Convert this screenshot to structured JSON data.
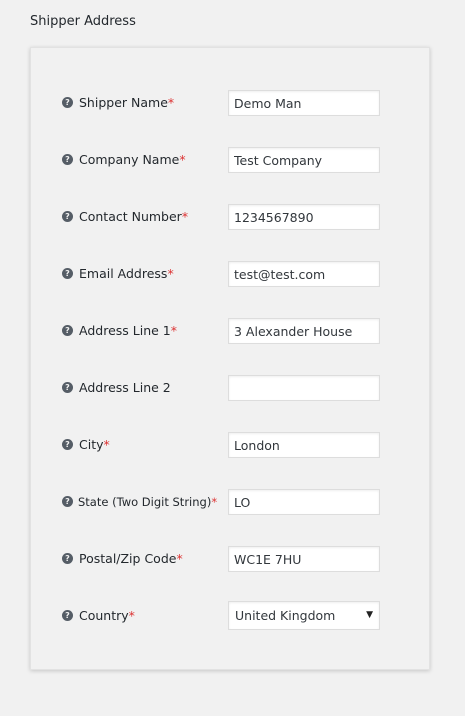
{
  "section": {
    "title": "Shipper Address"
  },
  "help_icon_glyph": "?",
  "required_marker": "*",
  "fields": [
    {
      "label": "Shipper Name",
      "required": true,
      "value": "Demo Man"
    },
    {
      "label": "Company Name",
      "required": true,
      "value": "Test Company"
    },
    {
      "label": "Contact Number",
      "required": true,
      "value": "1234567890"
    },
    {
      "label": "Email Address",
      "required": true,
      "value": "test@test.com"
    },
    {
      "label": "Address Line 1",
      "required": true,
      "value": "3 Alexander House"
    },
    {
      "label": "Address Line 2",
      "required": false,
      "value": ""
    },
    {
      "label": "City",
      "required": true,
      "value": "London"
    },
    {
      "label": "State (Two Digit String)",
      "required": true,
      "value": "LO"
    },
    {
      "label": "Postal/Zip Code",
      "required": true,
      "value": "WC1E 7HU"
    },
    {
      "label": "Country",
      "required": true,
      "value": "United Kingdom",
      "type": "select"
    }
  ],
  "select_arrow_glyph": "▼",
  "colors": {
    "required": "#dc3232",
    "background": "#f1f1f1",
    "text": "#23282d"
  }
}
